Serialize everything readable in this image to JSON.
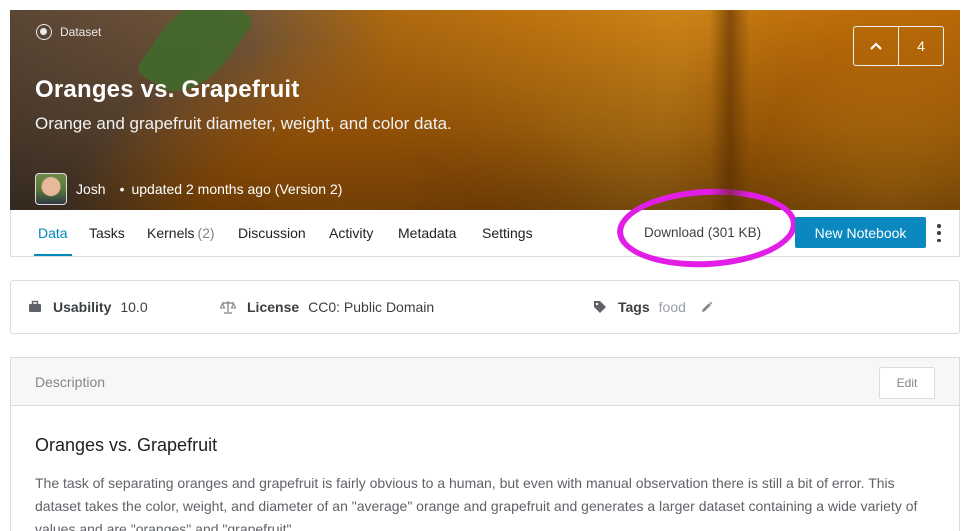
{
  "banner": {
    "type_label": "Dataset",
    "title": "Oranges vs. Grapefruit",
    "subtitle": "Orange and grapefruit diameter, weight, and color data.",
    "owner_name": "Josh",
    "bullet": "•",
    "updated_text": "updated 2 months ago (Version 2)",
    "vote_count": "4"
  },
  "tabs": [
    {
      "label": "Data"
    },
    {
      "label": "Tasks"
    },
    {
      "label": "Kernels",
      "count": "(2)"
    },
    {
      "label": "Discussion"
    },
    {
      "label": "Activity"
    },
    {
      "label": "Metadata"
    },
    {
      "label": "Settings"
    }
  ],
  "actions": {
    "download_label": "Download (301 KB)",
    "new_notebook_label": "New Notebook",
    "accent_color": "#008abc",
    "annotation_color": "#e21de6"
  },
  "meta": {
    "usability_label": "Usability",
    "usability_value": "10.0",
    "license_label": "License",
    "license_value": "CC0: Public Domain",
    "tags_label": "Tags",
    "tag": "food"
  },
  "description": {
    "header": "Description",
    "edit_label": "Edit",
    "title": "Oranges vs. Grapefruit",
    "body": "The task of separating oranges and grapefruit is fairly obvious to a human, but even with manual observation there is still a bit of error. This dataset takes the color, weight, and diameter of an \"average\" orange and grapefruit and generates a larger dataset containing a wide variety of values and are \"oranges\" and \"grapefruit\"."
  }
}
